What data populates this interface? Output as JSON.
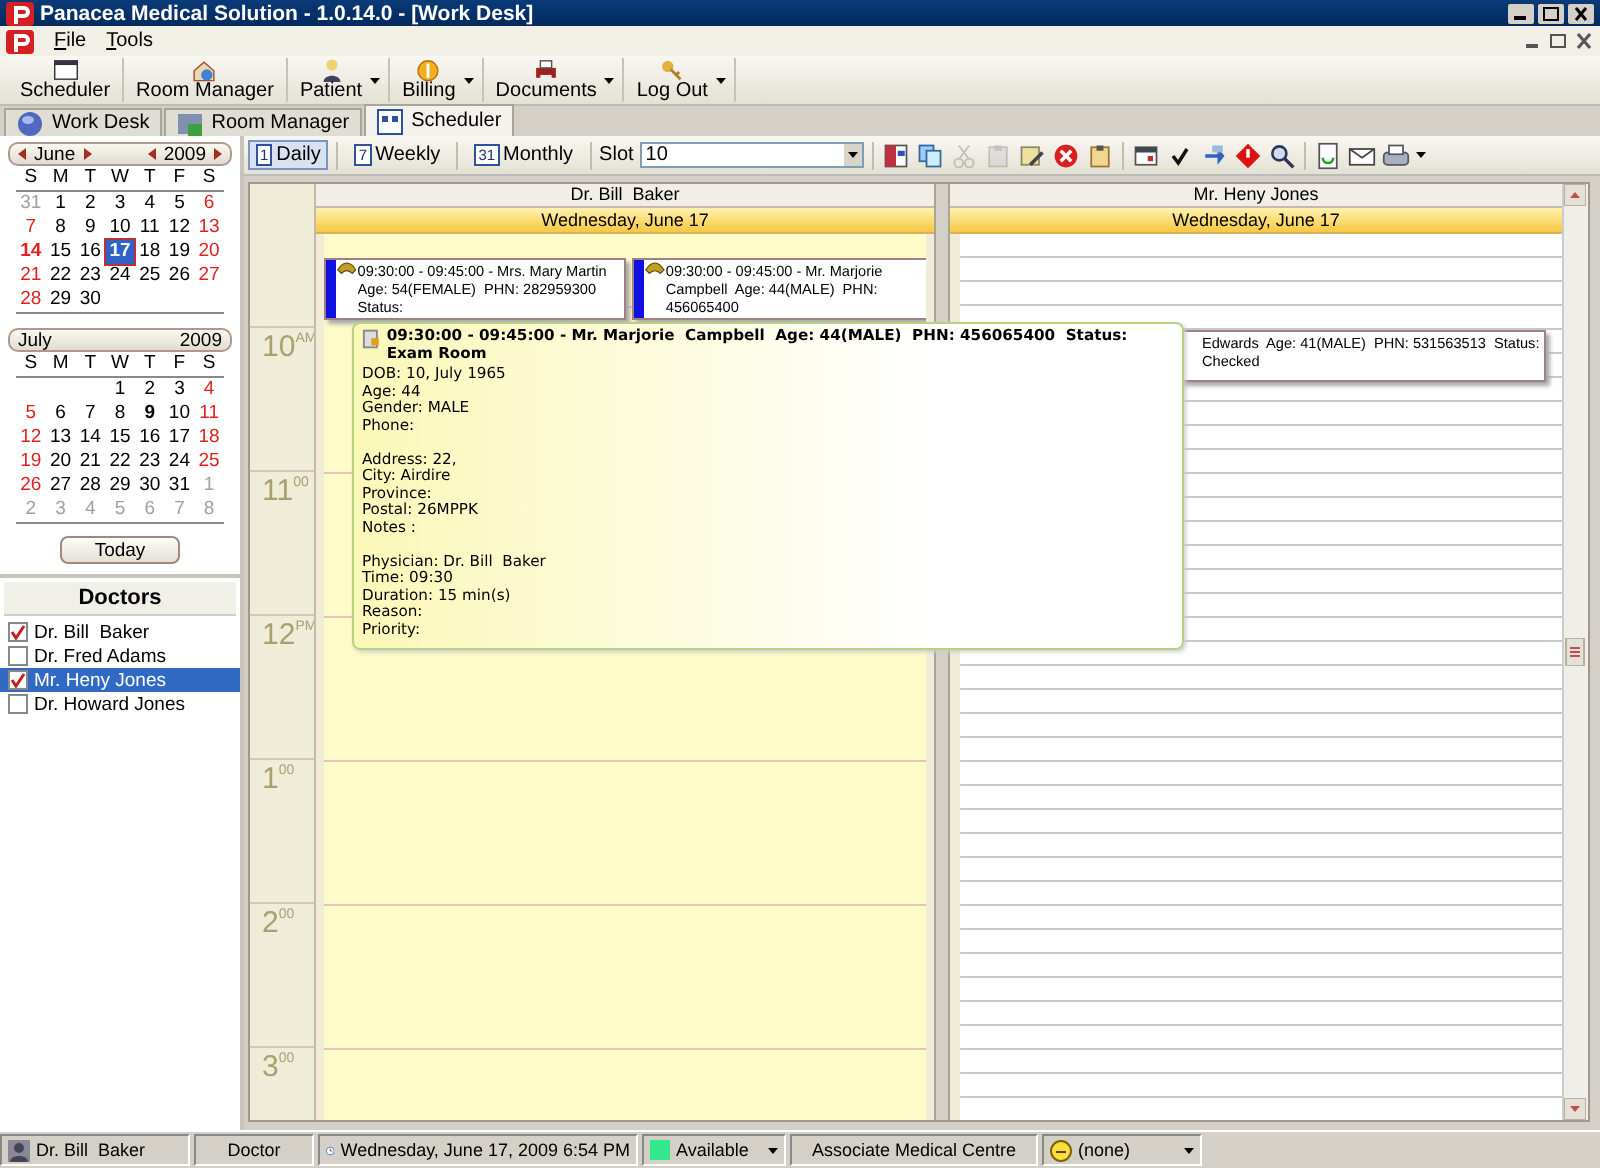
{
  "window": {
    "title": "Panacea Medical Solution - 1.0.14.0 - [Work Desk]"
  },
  "menu": [
    "File",
    "Tools"
  ],
  "toolbar": [
    {
      "label": "Scheduler",
      "dropdown": false
    },
    {
      "label": "Room Manager",
      "dropdown": false
    },
    {
      "label": "Patient",
      "dropdown": true
    },
    {
      "label": "Billing",
      "dropdown": true
    },
    {
      "label": "Documents",
      "dropdown": true
    },
    {
      "label": "Log Out",
      "dropdown": true
    }
  ],
  "tabs": [
    {
      "label": "Work Desk",
      "selected": false
    },
    {
      "label": "Room Manager",
      "selected": false
    },
    {
      "label": "Scheduler",
      "selected": true
    }
  ],
  "calendars": [
    {
      "month": "June",
      "year": "2009",
      "nav": true,
      "weekdays": [
        "S",
        "M",
        "T",
        "W",
        "T",
        "F",
        "S"
      ],
      "weeks": [
        [
          {
            "t": "31",
            "kind": "other",
            "selected": false
          },
          {
            "t": "1",
            "kind": "day",
            "selected": false
          },
          {
            "t": "2",
            "kind": "day",
            "selected": false
          },
          {
            "t": "3",
            "kind": "day",
            "selected": false
          },
          {
            "t": "4",
            "kind": "day",
            "selected": false
          },
          {
            "t": "5",
            "kind": "day",
            "selected": false
          },
          {
            "t": "6",
            "kind": "day",
            "selected": false
          }
        ],
        [
          {
            "t": "7",
            "kind": "day",
            "selected": false
          },
          {
            "t": "8",
            "kind": "day",
            "selected": false
          },
          {
            "t": "9",
            "kind": "day",
            "selected": false
          },
          {
            "t": "10",
            "kind": "day",
            "selected": false
          },
          {
            "t": "11",
            "kind": "day",
            "selected": false
          },
          {
            "t": "12",
            "kind": "day",
            "selected": false
          },
          {
            "t": "13",
            "kind": "day",
            "selected": false
          }
        ],
        [
          {
            "t": "14",
            "kind": "bold",
            "selected": false
          },
          {
            "t": "15",
            "kind": "day",
            "selected": false
          },
          {
            "t": "16",
            "kind": "day",
            "selected": false
          },
          {
            "t": "17",
            "kind": "day",
            "selected": true
          },
          {
            "t": "18",
            "kind": "day",
            "selected": false
          },
          {
            "t": "19",
            "kind": "day",
            "selected": false
          },
          {
            "t": "20",
            "kind": "day",
            "selected": false
          }
        ],
        [
          {
            "t": "21",
            "kind": "day",
            "selected": false
          },
          {
            "t": "22",
            "kind": "day",
            "selected": false
          },
          {
            "t": "23",
            "kind": "day",
            "selected": false
          },
          {
            "t": "24",
            "kind": "day",
            "selected": false
          },
          {
            "t": "25",
            "kind": "day",
            "selected": false
          },
          {
            "t": "26",
            "kind": "day",
            "selected": false
          },
          {
            "t": "27",
            "kind": "day",
            "selected": false
          }
        ],
        [
          {
            "t": "28",
            "kind": "day",
            "selected": false
          },
          {
            "t": "29",
            "kind": "day",
            "selected": false
          },
          {
            "t": "30",
            "kind": "day",
            "selected": false
          },
          {
            "kind": "blank"
          },
          {
            "kind": "blank"
          },
          {
            "kind": "blank"
          },
          {
            "kind": "blank"
          }
        ]
      ]
    },
    {
      "month": "July",
      "year": "2009",
      "nav": false,
      "weekdays": [
        "S",
        "M",
        "T",
        "W",
        "T",
        "F",
        "S"
      ],
      "weeks": [
        [
          {
            "kind": "blank"
          },
          {
            "kind": "blank"
          },
          {
            "kind": "blank"
          },
          {
            "t": "1",
            "kind": "day",
            "selected": false
          },
          {
            "t": "2",
            "kind": "day",
            "selected": false
          },
          {
            "t": "3",
            "kind": "day",
            "selected": false
          },
          {
            "t": "4",
            "kind": "day",
            "selected": false
          }
        ],
        [
          {
            "t": "5",
            "kind": "day",
            "selected": false
          },
          {
            "t": "6",
            "kind": "day",
            "selected": false
          },
          {
            "t": "7",
            "kind": "day",
            "selected": false
          },
          {
            "t": "8",
            "kind": "day",
            "selected": false
          },
          {
            "t": "9",
            "kind": "bold",
            "selected": false
          },
          {
            "t": "10",
            "kind": "day",
            "selected": false
          },
          {
            "t": "11",
            "kind": "day",
            "selected": false
          }
        ],
        [
          {
            "t": "12",
            "kind": "day",
            "selected": false
          },
          {
            "t": "13",
            "kind": "day",
            "selected": false
          },
          {
            "t": "14",
            "kind": "day",
            "selected": false
          },
          {
            "t": "15",
            "kind": "day",
            "selected": false
          },
          {
            "t": "16",
            "kind": "day",
            "selected": false
          },
          {
            "t": "17",
            "kind": "day",
            "selected": false
          },
          {
            "t": "18",
            "kind": "day",
            "selected": false
          }
        ],
        [
          {
            "t": "19",
            "kind": "day",
            "selected": false
          },
          {
            "t": "20",
            "kind": "day",
            "selected": false
          },
          {
            "t": "21",
            "kind": "day",
            "selected": false
          },
          {
            "t": "22",
            "kind": "day",
            "selected": false
          },
          {
            "t": "23",
            "kind": "day",
            "selected": false
          },
          {
            "t": "24",
            "kind": "day",
            "selected": false
          },
          {
            "t": "25",
            "kind": "day",
            "selected": false
          }
        ],
        [
          {
            "t": "26",
            "kind": "day",
            "selected": false
          },
          {
            "t": "27",
            "kind": "day",
            "selected": false
          },
          {
            "t": "28",
            "kind": "day",
            "selected": false
          },
          {
            "t": "29",
            "kind": "day",
            "selected": false
          },
          {
            "t": "30",
            "kind": "day",
            "selected": false
          },
          {
            "t": "31",
            "kind": "day",
            "selected": false
          },
          {
            "t": "1",
            "kind": "other",
            "selected": false
          }
        ],
        [
          {
            "t": "2",
            "kind": "other",
            "selected": false
          },
          {
            "t": "3",
            "kind": "other",
            "selected": false
          },
          {
            "t": "4",
            "kind": "other",
            "selected": false
          },
          {
            "t": "5",
            "kind": "other",
            "selected": false
          },
          {
            "t": "6",
            "kind": "other",
            "selected": false
          },
          {
            "t": "7",
            "kind": "other",
            "selected": false
          },
          {
            "t": "8",
            "kind": "other",
            "selected": false
          }
        ]
      ]
    }
  ],
  "today_button": "Today",
  "doctors": {
    "title": "Doctors",
    "items": [
      {
        "name": "Dr. Bill  Baker",
        "checked": true,
        "selected": false
      },
      {
        "name": "Dr. Fred Adams",
        "checked": false,
        "selected": false
      },
      {
        "name": "Mr. Heny Jones",
        "checked": true,
        "selected": true
      },
      {
        "name": "Dr. Howard Jones",
        "checked": false,
        "selected": false
      }
    ]
  },
  "views": [
    {
      "num": "1",
      "label": "Daily",
      "selected": true
    },
    {
      "num": "7",
      "label": "Weekly",
      "selected": false
    },
    {
      "num": "31",
      "label": "Monthly",
      "selected": false
    }
  ],
  "slot": {
    "label": "Slot",
    "value": "10"
  },
  "actions": [
    {
      "disabled": false
    },
    {
      "disabled": false
    },
    {
      "disabled": true
    },
    {
      "disabled": true
    },
    {
      "disabled": false
    },
    {
      "disabled": false
    },
    {
      "disabled": false
    },
    {
      "disabled": false
    },
    {
      "disabled": false
    },
    {
      "disabled": false
    },
    {
      "disabled": false
    },
    {
      "disabled": false
    },
    {
      "disabled": false
    },
    {
      "disabled": false
    },
    {
      "disabled": false
    }
  ],
  "hours": [
    {
      "hour": "10",
      "suffix": "AM"
    },
    {
      "hour": "11",
      "suffix": "00"
    },
    {
      "hour": "12",
      "suffix": "PM"
    },
    {
      "hour": "1",
      "suffix": "00"
    },
    {
      "hour": "2",
      "suffix": "00"
    },
    {
      "hour": "3",
      "suffix": "00"
    }
  ],
  "columns": [
    {
      "doctor": "Dr. Bill  Baker",
      "date": "Wednesday, June 17",
      "appointments": [
        {
          "kind": "phone",
          "lines": [
            "09:30:00 - 09:45:00 - Mrs. Mary Martin",
            "Age: 54(FEMALE)  PHN: 282959300  Status:"
          ]
        },
        {
          "kind": "phone",
          "lines": [
            "09:30:00 - 09:45:00 - Mr. Marjorie",
            "Campbell  Age: 44(MALE)  PHN: 456065400"
          ]
        }
      ]
    },
    {
      "doctor": "Mr. Heny Jones",
      "date": "Wednesday, June 17",
      "appointments": [
        {
          "kind": "plain",
          "lines": [
            "Edwards  Age: 41(MALE)  PHN: 531563513  Status: Checked"
          ]
        }
      ]
    }
  ],
  "tooltip": {
    "title": "09:30:00 - 09:45:00 - Mr. Marjorie  Campbell  Age: 44(MALE)  PHN: 456065400  Status: Exam Room",
    "groups": [
      [
        "DOB: 10, July 1965",
        "Age: 44",
        "Gender: MALE",
        "Phone:"
      ],
      [
        "Address: 22,",
        "City: Airdire",
        "Province:",
        "Postal: 26MPPK",
        "Notes :"
      ],
      [
        "Physician: Dr. Bill  Baker",
        "Time: 09:30",
        "Duration: 15 min(s)",
        "Reason:",
        "Priority:"
      ]
    ]
  },
  "status_bar": [
    {
      "kind": "user",
      "text": "Dr. Bill  Baker",
      "dropdown": false
    },
    {
      "kind": "plain",
      "text": "Doctor",
      "dropdown": false
    },
    {
      "kind": "clock",
      "text": "Wednesday, June 17, 2009 6:54 PM",
      "dropdown": false
    },
    {
      "kind": "status",
      "text": "Available",
      "color": "#33e88c",
      "dropdown": true
    },
    {
      "kind": "plain",
      "text": "Associate Medical Centre",
      "dropdown": false
    },
    {
      "kind": "priority",
      "text": "(none)",
      "dropdown": true
    }
  ]
}
